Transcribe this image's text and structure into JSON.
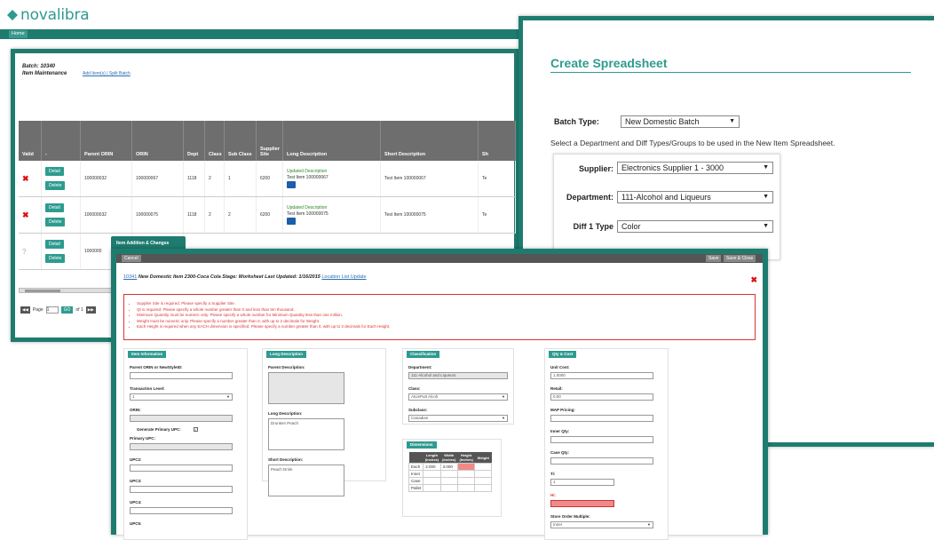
{
  "brand": {
    "name": "novalibra",
    "color": "#2e9b8f"
  },
  "nav": {
    "home_label": "Home"
  },
  "batch": {
    "title": "Batch: 10340",
    "subtitle": "Item Maintenance",
    "links": "Add Item(s) | Split Batch",
    "columns": [
      "Valid",
      "-",
      "Parent ORIN",
      "ORIN",
      "Dept",
      "Class",
      "Sub Class",
      "Supplier Site",
      "Long Description",
      "Short Description",
      "Sh"
    ],
    "rows": [
      {
        "valid": "✖",
        "parent_orin": "100000032",
        "orin": "100000067",
        "dept": "1118",
        "class": "2",
        "subclass": "1",
        "site": "6200",
        "long_status": "Updated Description",
        "long_desc": "Test Item 100000067",
        "short_desc": "Test Item 100000067",
        "sh": "Te"
      },
      {
        "valid": "✖",
        "parent_orin": "100000032",
        "orin": "100000075",
        "dept": "1118",
        "class": "2",
        "subclass": "2",
        "site": "6200",
        "long_status": "Updated Description",
        "long_desc": "Test Item 100000075",
        "short_desc": "Test Item 100000075",
        "sh": "Te"
      },
      {
        "valid": "?",
        "parent_orin": "1000000",
        "orin": "",
        "dept": "",
        "class": "",
        "subclass": "",
        "site": "",
        "long_status": "",
        "long_desc": "",
        "short_desc": "",
        "sh": ""
      }
    ],
    "detail_label": "Detail",
    "delete_label": "Delete",
    "pager": {
      "page_label": "Page",
      "page_value": "1",
      "go_label": "GO",
      "of_label": "of 1"
    }
  },
  "sheet": {
    "title": "Create Spreadsheet",
    "batch_type_label": "Batch Type:",
    "batch_type_value": "New Domestic Batch",
    "instructions": "Select a Department and Diff Types/Groups to be used in the New Item Spreadsheet.",
    "supplier_label": "Supplier:",
    "supplier_value": "Electronics Supplier 1 - 3000",
    "department_label": "Department:",
    "department_value": "111-Alcohol and Liqueurs",
    "diff1_label": "Diff 1 Type",
    "diff1_value": "Color"
  },
  "modal": {
    "tab_label": "Item Addition & Changes",
    "cancel_label": "Cancel",
    "save_label": "Save",
    "save_close_label": "Save & Close",
    "header_link": "10341",
    "header_text": "New Domestic Item  2300-Coca Cola  Stage: Worksheet  Last Updated: 1/16/2015",
    "header_sublink": "Location List Update",
    "errors": [
      "Supplier Site is required. Please specify a Supplier Site.",
      "Qt is required. Please specify a whole number greater than 0 and less than ten thousand.",
      "Minimum Quantity must be numeric only. Please specify a whole number for Minimum Quantity less than one million.",
      "Weight must be numeric only. Please specify a number greater than 0, with up to 2 decimals for Weight.",
      "Each Height is required when any EACH dimension is specified. Please specify a number greater than 0, with up to 3 decimals for Each Height."
    ],
    "item_info": {
      "head": "Item Information",
      "parent_label": "Parent ORIN or NewStyleID:",
      "txn_label": "Transaction Level:",
      "txn_value": "1",
      "orin_label": "ORIN:",
      "gen_upc_label": "Generate Primary UPC:",
      "gen_upc_check": "✓",
      "primary_upc_label": "Primary UPC:",
      "upc2_label": "UPC2:",
      "upc3_label": "UPC3:",
      "upc4_label": "UPC4:",
      "upc5_label": "UPC5:"
    },
    "long_desc": {
      "head": "Long Description",
      "parent_desc_label": "Parent Description:",
      "long_desc_label": "Long Description:",
      "long_desc_value": "Drunken Peach",
      "short_desc_label": "Short Description:",
      "short_desc_value": "Peach Drink"
    },
    "classification": {
      "head": "Classification",
      "dept_label": "Department:",
      "dept_value": "111-Alcohol and Liqueurs",
      "class_label": "Class:",
      "class_value": "Alc/ePutt Alcoh",
      "subclass_label": "Subclass:",
      "subclass_value": "Canadian"
    },
    "dimensions": {
      "head": "Dimensions",
      "columns": [
        "",
        "Length (inches)",
        "Width (inches)",
        "Height (inches)",
        "Weight"
      ],
      "rows": [
        {
          "label": "Each",
          "length": "2.000",
          "width": "3.000",
          "height": "",
          "weight": ""
        },
        {
          "label": "Inner",
          "length": "",
          "width": "",
          "height": "",
          "weight": ""
        },
        {
          "label": "Case",
          "length": "",
          "width": "",
          "height": "",
          "weight": ""
        },
        {
          "label": "Pallet",
          "length": "",
          "width": "",
          "height": "",
          "weight": ""
        }
      ]
    },
    "qty_cost": {
      "head": "Qty & Cost",
      "unit_cost_label": "Unit Cost:",
      "unit_cost_value": "1.0000",
      "retail_label": "Retail:",
      "retail_value": "0.00",
      "map_label": "MAP Pricing:",
      "inner_label": "Inner Qty:",
      "case_label": "Case Qty:",
      "ti_label": "Ti:",
      "ti_value": "1",
      "hi_label": "Hi:",
      "som_label": "Store Order Multiple:",
      "som_value": "Inner"
    }
  }
}
